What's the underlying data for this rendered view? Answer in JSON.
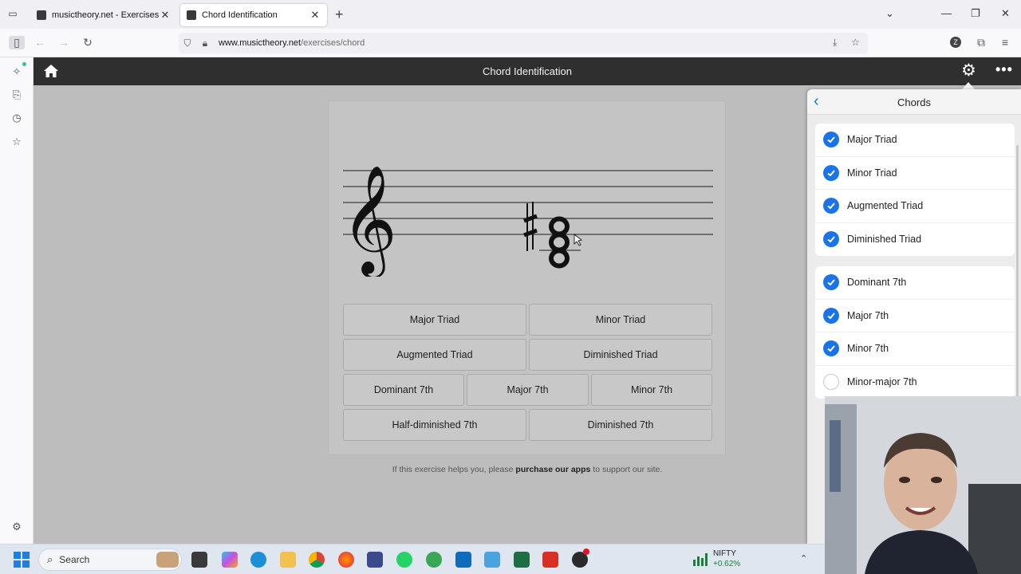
{
  "browser": {
    "tabs": [
      {
        "label": "musictheory.net - Exercises",
        "active": false
      },
      {
        "label": "Chord Identification",
        "active": true
      }
    ],
    "url_host": "www.musictheory.net",
    "url_path": "/exercises/chord"
  },
  "app": {
    "title": "Chord Identification",
    "answers": {
      "major_triad": "Major Triad",
      "minor_triad": "Minor Triad",
      "augmented_triad": "Augmented Triad",
      "diminished_triad": "Diminished Triad",
      "dominant_7th": "Dominant 7th",
      "major_7th": "Major 7th",
      "minor_7th": "Minor 7th",
      "half_diminished_7th": "Half-diminished 7th",
      "diminished_7th": "Diminished 7th"
    },
    "footer": {
      "prefix": "If this exercise helps you, please ",
      "link": "purchase our apps",
      "suffix": " to support our site."
    }
  },
  "settings_panel": {
    "title": "Chords",
    "triads": [
      {
        "label": "Major Triad",
        "checked": true
      },
      {
        "label": "Minor Triad",
        "checked": true
      },
      {
        "label": "Augmented Triad",
        "checked": true
      },
      {
        "label": "Diminished Triad",
        "checked": true
      }
    ],
    "sevenths": [
      {
        "label": "Dominant 7th",
        "checked": true
      },
      {
        "label": "Major 7th",
        "checked": true
      },
      {
        "label": "Minor 7th",
        "checked": true
      },
      {
        "label": "Minor-major 7th",
        "checked": false
      }
    ]
  },
  "taskbar": {
    "search_label": "Search",
    "ticker_name": "NIFTY",
    "ticker_change": "+0.62%"
  },
  "colors": {
    "accent": "#1a73e8",
    "header_bg": "#2f2f2f",
    "content_bg": "#bdbdbd"
  }
}
